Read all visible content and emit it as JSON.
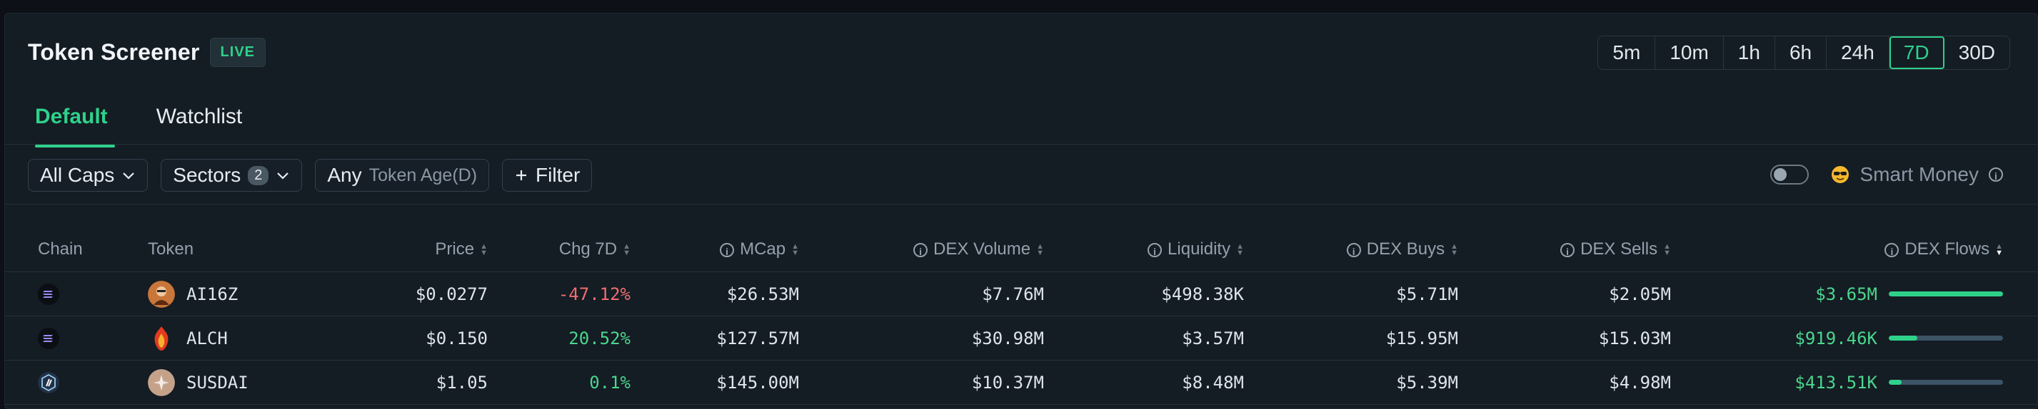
{
  "header": {
    "title": "Token Screener",
    "live_badge": "LIVE"
  },
  "timeframes": [
    "5m",
    "10m",
    "1h",
    "6h",
    "24h",
    "7D",
    "30D"
  ],
  "active_timeframe": "7D",
  "tabs": [
    {
      "label": "Default",
      "active": true
    },
    {
      "label": "Watchlist",
      "active": false
    }
  ],
  "filters": {
    "caps": "All Caps",
    "sectors": "Sectors",
    "sectors_count": "2",
    "age_value": "Any",
    "age_label": "Token Age(D)",
    "filter": "Filter"
  },
  "smart_money": {
    "label": "Smart Money",
    "enabled": false
  },
  "columns": {
    "chain": "Chain",
    "token": "Token",
    "price": "Price",
    "chg": "Chg 7D",
    "mcap": "MCap",
    "volume": "DEX Volume",
    "liquidity": "Liquidity",
    "buys": "DEX Buys",
    "sells": "DEX Sells",
    "flows": "DEX Flows"
  },
  "rows": [
    {
      "chain": "solana",
      "token": "AI16Z",
      "price": "$0.0277",
      "chg": "-47.12%",
      "mcap": "$26.53M",
      "volume": "$7.76M",
      "liquidity": "$498.38K",
      "buys": "$5.71M",
      "sells": "$2.05M",
      "flows": "$3.65M",
      "flow_ratio": 1.0
    },
    {
      "chain": "solana",
      "token": "ALCH",
      "price": "$0.150",
      "chg": "20.52%",
      "mcap": "$127.57M",
      "volume": "$30.98M",
      "liquidity": "$3.57M",
      "buys": "$15.95M",
      "sells": "$15.03M",
      "flows": "$919.46K",
      "flow_ratio": 0.25
    },
    {
      "chain": "arbitrum",
      "token": "SUSDAI",
      "price": "$1.05",
      "chg": "0.1%",
      "mcap": "$145.00M",
      "volume": "$10.37M",
      "liquidity": "$8.48M",
      "buys": "$5.39M",
      "sells": "$4.98M",
      "flows": "$413.51K",
      "flow_ratio": 0.11
    }
  ],
  "colors": {
    "accent": "#2fd18a",
    "negative": "#f26d6d",
    "positive": "#4bd68c",
    "background": "#141c24"
  }
}
